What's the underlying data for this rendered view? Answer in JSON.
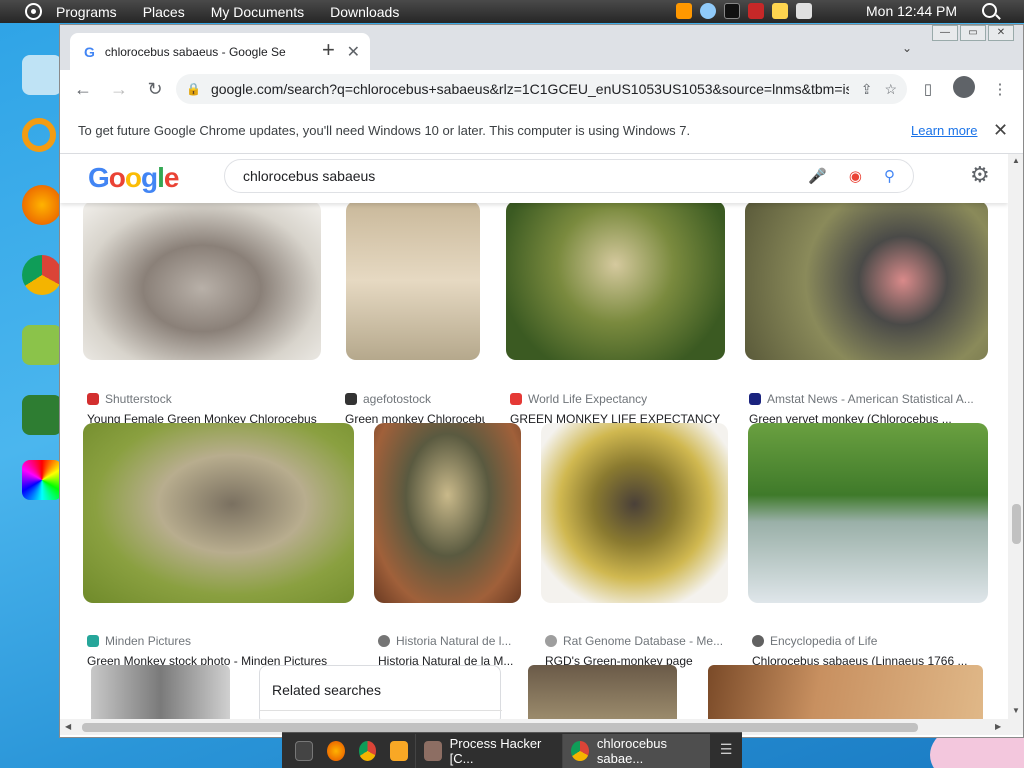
{
  "desktop_panel": {
    "menu": [
      "Programs",
      "Places",
      "My Documents",
      "Downloads"
    ],
    "clock": "Mon 12:44 PM"
  },
  "taskbar": {
    "tasks": [
      "Process Hacker [C...",
      "chlorocebus sabae..."
    ]
  },
  "browser": {
    "tab_title": "chlorocebus sabaeus - Google Se",
    "url": "google.com/search?q=chlorocebus+sabaeus&rlz=1C1GCEU_enUS1053US1053&source=lnms&tbm=is...",
    "infobar_text": "To get future Google Chrome updates, you'll need Windows 10 or later. This computer is using Windows 7.",
    "infobar_link": "Learn more"
  },
  "google": {
    "logo": "Google",
    "query": "chlorocebus sabaeus"
  },
  "results": [
    {
      "source": "Shutterstock",
      "caption": "Young Female Green Monkey Chlorocebus ...",
      "color": "#d32f2f"
    },
    {
      "source": "agefotostock",
      "caption": "Green monkey Chlorocebus ...",
      "color": "#333333"
    },
    {
      "source": "World Life Expectancy",
      "caption": "GREEN MONKEY LIFE EXPECTANCY",
      "color": "#e53935"
    },
    {
      "source": "Amstat News - American Statistical A...",
      "caption": "Green vervet monkey (Chlorocebus ...",
      "color": "#1a237e"
    },
    {
      "source": "Minden Pictures",
      "caption": "Green Monkey stock photo - Minden Pictures",
      "color": "#26a69a"
    },
    {
      "source": "Historia Natural de l...",
      "caption": "Historia Natural de la M...",
      "color": "#757575"
    },
    {
      "source": "Rat Genome Database - Me...",
      "caption": "RGD's Green-monkey page",
      "color": "#9e9e9e"
    },
    {
      "source": "Encyclopedia of Life",
      "caption": "Chlorocebus sabaeus (Linnaeus 1766 ...",
      "color": "#616161"
    }
  ],
  "related_searches": "Related searches"
}
